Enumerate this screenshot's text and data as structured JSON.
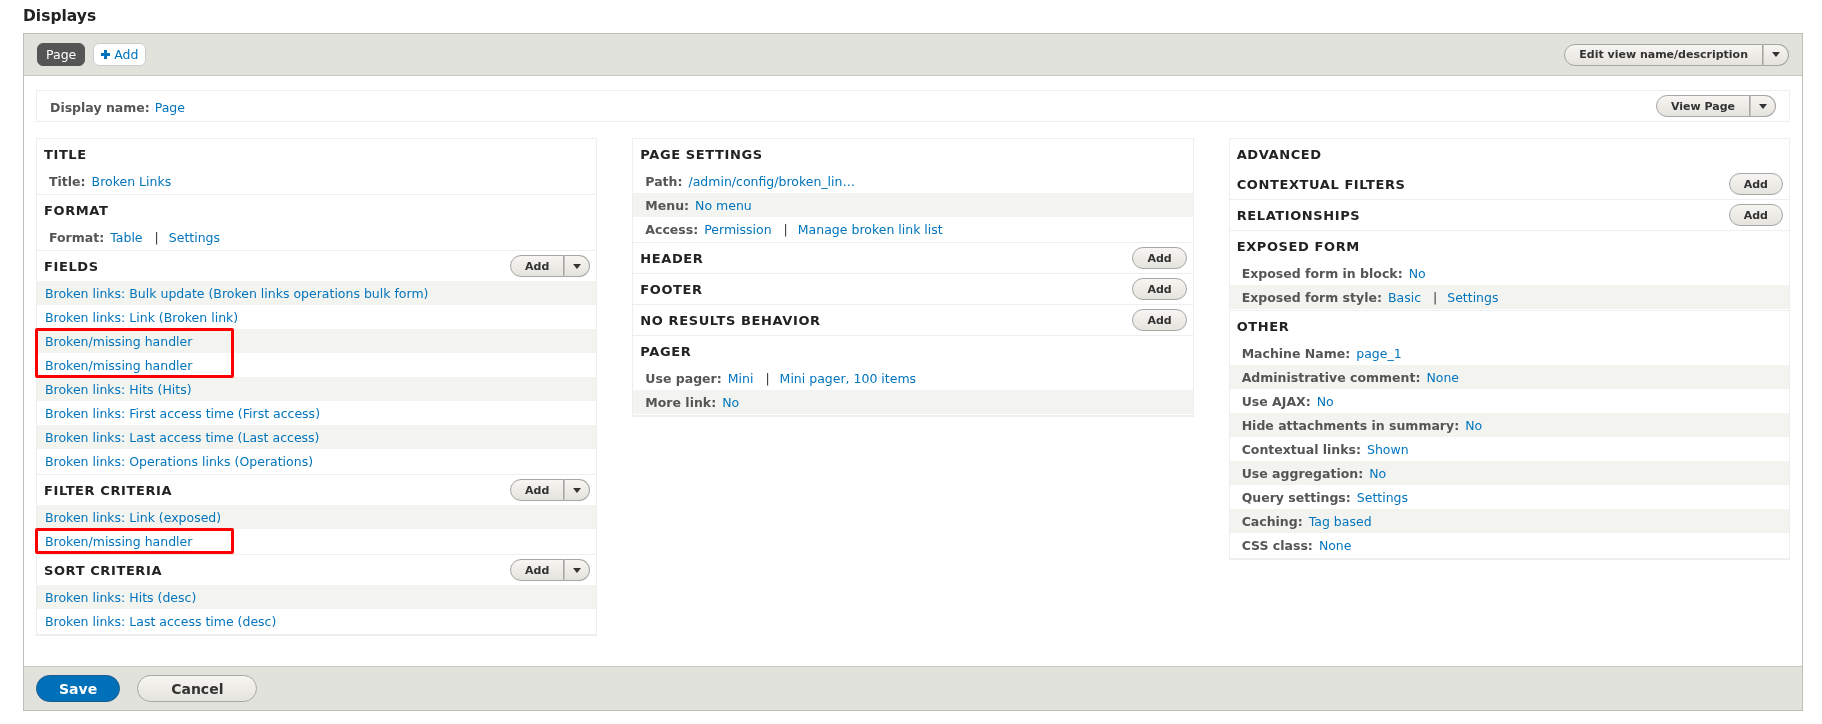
{
  "page_title": "Displays",
  "display_tabs": [
    {
      "label": "Page",
      "selected": true
    }
  ],
  "add_display": {
    "label": "Add"
  },
  "edit_view_button": {
    "label": "Edit view name/description",
    "dropdown": true
  },
  "display_name": {
    "label": "Display name:",
    "value": "Page"
  },
  "view_page_button": {
    "label": "View Page",
    "dropdown": true
  },
  "columns": [
    {
      "sections": [
        {
          "kind": "settings",
          "title": "TITLE",
          "items": [
            {
              "label": "Title:",
              "values": [
                "Broken Links"
              ]
            }
          ]
        },
        {
          "kind": "settings",
          "title": "FORMAT",
          "items": [
            {
              "label": "Format:",
              "values": [
                "Table",
                "Settings"
              ],
              "separator": "|"
            }
          ]
        },
        {
          "kind": "list",
          "title": "FIELDS",
          "button": {
            "label": "Add",
            "dropdown": true
          },
          "items": [
            {
              "text": "Broken links: Bulk update (Broken links operations bulk form)",
              "highlighted": false
            },
            {
              "text": "Broken links: Link (Broken link)",
              "highlighted": false
            },
            {
              "text": "Broken/missing handler",
              "highlighted": true
            },
            {
              "text": "Broken/missing handler",
              "highlighted": true
            },
            {
              "text": "Broken links: Hits (Hits)",
              "highlighted": false
            },
            {
              "text": "Broken links: First access time (First access)",
              "highlighted": false
            },
            {
              "text": "Broken links: Last access time (Last access)",
              "highlighted": false
            },
            {
              "text": "Broken links: Operations links (Operations)",
              "highlighted": false
            }
          ]
        },
        {
          "kind": "list",
          "title": "FILTER CRITERIA",
          "button": {
            "label": "Add",
            "dropdown": true
          },
          "items": [
            {
              "text": "Broken links: Link (exposed)",
              "highlighted": false
            },
            {
              "text": "Broken/missing handler",
              "highlighted": true
            }
          ]
        },
        {
          "kind": "list",
          "title": "SORT CRITERIA",
          "button": {
            "label": "Add",
            "dropdown": true
          },
          "items": [
            {
              "text": "Broken links: Hits (desc)",
              "highlighted": false
            },
            {
              "text": "Broken links: Last access time (desc)",
              "highlighted": false
            }
          ]
        }
      ]
    },
    {
      "sections": [
        {
          "kind": "settings",
          "title": "PAGE SETTINGS",
          "items": [
            {
              "label": "Path:",
              "values": [
                "/admin/config/broken_lin…"
              ]
            },
            {
              "label": "Menu:",
              "values": [
                "No menu"
              ]
            },
            {
              "label": "Access:",
              "values": [
                "Permission",
                "Manage broken link list"
              ],
              "separator": "|"
            }
          ]
        },
        {
          "kind": "list",
          "title": "HEADER",
          "button": {
            "label": "Add",
            "dropdown": false
          }
        },
        {
          "kind": "list",
          "title": "FOOTER",
          "button": {
            "label": "Add",
            "dropdown": false
          }
        },
        {
          "kind": "list",
          "title": "NO RESULTS BEHAVIOR",
          "button": {
            "label": "Add",
            "dropdown": false
          }
        },
        {
          "kind": "settings",
          "title": "PAGER",
          "items": [
            {
              "label": "Use pager:",
              "values": [
                "Mini",
                "Mini pager, 100 items"
              ],
              "separator": "|"
            },
            {
              "label": "More link:",
              "values": [
                "No"
              ]
            }
          ]
        }
      ]
    },
    {
      "sections": [
        {
          "kind": "heading",
          "title": "ADVANCED"
        },
        {
          "kind": "list",
          "title": "CONTEXTUAL FILTERS",
          "button": {
            "label": "Add",
            "dropdown": false
          }
        },
        {
          "kind": "list",
          "title": "RELATIONSHIPS",
          "button": {
            "label": "Add",
            "dropdown": false
          }
        },
        {
          "kind": "settings",
          "title": "EXPOSED FORM",
          "items": [
            {
              "label": "Exposed form in block:",
              "values": [
                "No"
              ]
            },
            {
              "label": "Exposed form style:",
              "values": [
                "Basic",
                "Settings"
              ],
              "separator": "|"
            }
          ]
        },
        {
          "kind": "settings",
          "title": "OTHER",
          "items": [
            {
              "label": "Machine Name:",
              "values": [
                "page_1"
              ]
            },
            {
              "label": "Administrative comment:",
              "values": [
                "None"
              ]
            },
            {
              "label": "Use AJAX:",
              "values": [
                "No"
              ]
            },
            {
              "label": "Hide attachments in summary:",
              "values": [
                "No"
              ]
            },
            {
              "label": "Contextual links:",
              "values": [
                "Shown"
              ]
            },
            {
              "label": "Use aggregation:",
              "values": [
                "No"
              ]
            },
            {
              "label": "Query settings:",
              "values": [
                "Settings"
              ]
            },
            {
              "label": "Caching:",
              "values": [
                "Tag based"
              ]
            },
            {
              "label": "CSS class:",
              "values": [
                "None"
              ]
            }
          ]
        }
      ]
    }
  ],
  "footer_buttons": [
    {
      "label": "Save",
      "kind": "primary"
    },
    {
      "label": "Cancel",
      "kind": "secondary"
    }
  ]
}
